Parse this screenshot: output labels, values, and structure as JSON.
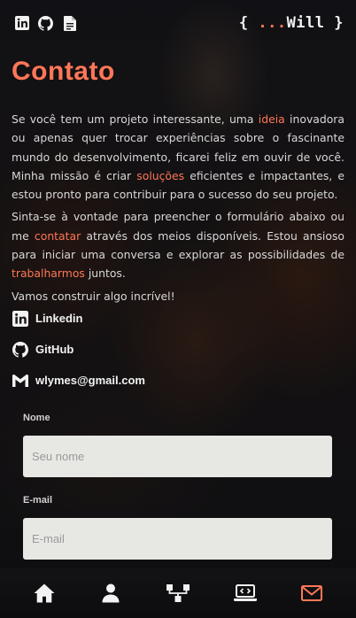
{
  "header": {
    "logo_open": "{ ",
    "logo_dots": "...",
    "logo_name": "Will",
    "logo_close": " }",
    "icons": [
      "linkedin-icon",
      "github-icon",
      "document-icon"
    ]
  },
  "title": "Contato",
  "intro": {
    "p1_a": "Se você tem um projeto interessante, uma ",
    "p1_hl1": "ideia",
    "p1_b": " inovadora ou apenas quer trocar experiências sobre o fascinante mundo do desenvolvimento, ficarei feliz em ouvir de você. Minha missão é criar ",
    "p1_hl2": "soluções",
    "p1_c": " eficientes e impactantes, e estou pronto para contribuir para o sucesso do seu projeto.",
    "p2_a": "Sinta-se à vontade para preencher o formulário abaixo ou me ",
    "p2_hl1": "contatar",
    "p2_b": " através dos meios disponíveis. Estou ansioso para iniciar uma conversa e explorar as possibilidades de ",
    "p2_hl2": "trabalharmos",
    "p2_c": " juntos.",
    "p3": "Vamos construir algo incrível!"
  },
  "contact_links": {
    "linkedin": "Linkedin",
    "github": "GitHub",
    "email": "wlymes@gmail.com"
  },
  "form": {
    "name_label": "Nome",
    "name_placeholder": "Seu nome",
    "email_label": "E-mail",
    "email_placeholder": "E-mail"
  },
  "nav": {
    "items": [
      "home-icon",
      "user-icon",
      "project-tree-icon",
      "laptop-code-icon",
      "mail-icon"
    ],
    "active": "mail-icon"
  },
  "colors": {
    "accent": "#ff7757",
    "text": "#d8d8d8",
    "input_bg": "#e7e7e4"
  }
}
